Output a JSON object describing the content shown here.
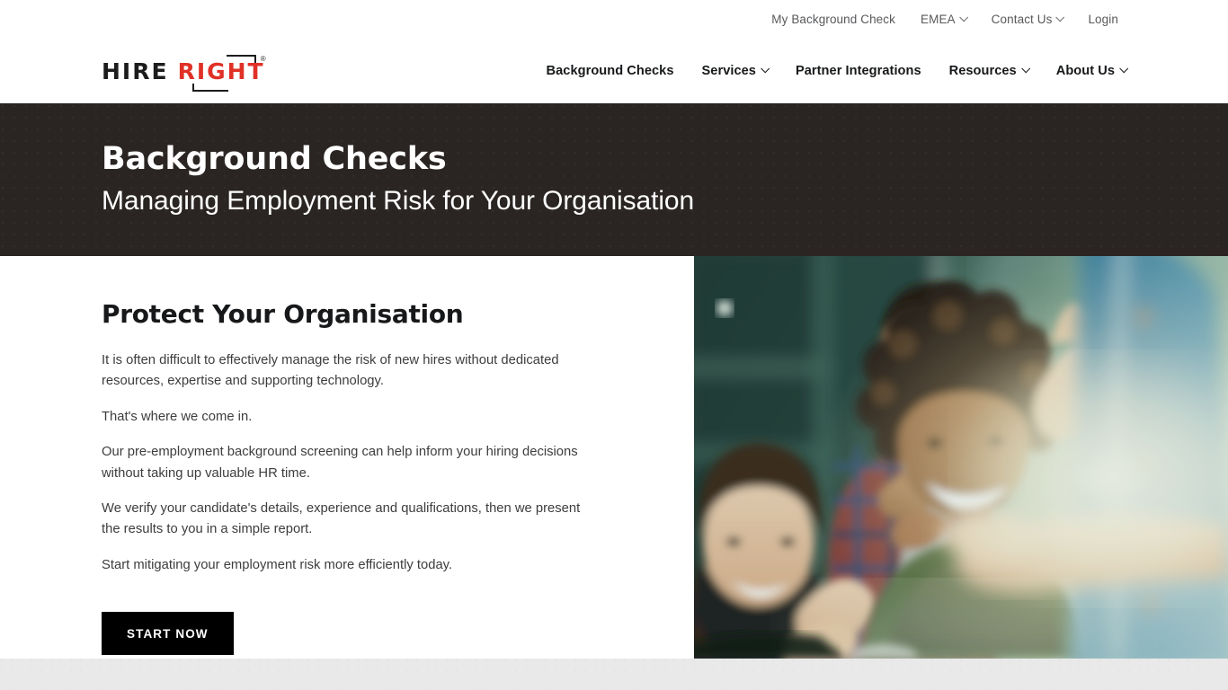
{
  "utility_nav": {
    "items": [
      {
        "label": "My Background Check",
        "has_chevron": false,
        "icon": null
      },
      {
        "label": "EMEA",
        "has_chevron": true,
        "icon": "chevron-down-icon"
      },
      {
        "label": "Contact Us",
        "has_chevron": true,
        "icon": "chevron-down-icon"
      },
      {
        "label": "Login",
        "has_chevron": false,
        "icon": null
      }
    ]
  },
  "logo": {
    "part_one": "HIRE",
    "part_two": "RIGHT",
    "registered_mark": "®",
    "color_dark": "#1c1c1c",
    "color_red": "#e03127"
  },
  "main_nav": {
    "items": [
      {
        "label": "Background Checks",
        "has_chevron": false,
        "icon": null
      },
      {
        "label": "Services",
        "has_chevron": true,
        "icon": "chevron-down-icon"
      },
      {
        "label": "Partner Integrations",
        "has_chevron": false,
        "icon": null
      },
      {
        "label": "Resources",
        "has_chevron": true,
        "icon": "chevron-down-icon"
      },
      {
        "label": "About Us",
        "has_chevron": true,
        "icon": "chevron-down-icon"
      }
    ]
  },
  "hero": {
    "title": "Background Checks",
    "subtitle": "Managing Employment Risk for Your Organisation",
    "background_color": "#2a2523",
    "text_color": "#ffffff"
  },
  "main": {
    "heading": "Protect Your Organisation",
    "paragraphs": [
      "It is often difficult to effectively manage the risk of new hires without dedicated resources, expertise and supporting technology.",
      "That's where we come in.",
      "Our pre-employment background screening can help inform your hiring decisions without taking up valuable HR time.",
      "We verify your candidate's details, experience and qualifications, then we present the results to you in a simple report.",
      "Start mitigating your employment risk more efficiently today."
    ],
    "cta_label": "START NOW",
    "cta_background": "#000000",
    "cta_text_color": "#ffffff"
  },
  "photo": {
    "alt": "Group of smiling colleagues clapping in a bright office with sunlight flare"
  },
  "bottom_strip": {
    "background_color": "#e9e9e9"
  }
}
